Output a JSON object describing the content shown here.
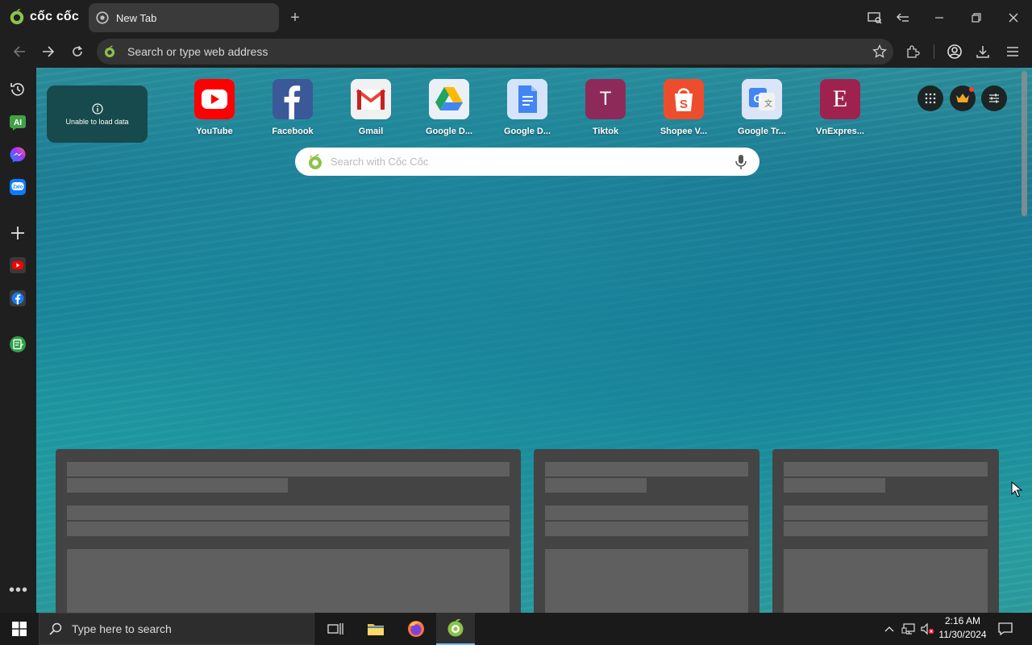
{
  "browser": {
    "brand_name": "cốc cốc",
    "tab_title": "New Tab",
    "address_placeholder": "Search or type web address"
  },
  "newtab": {
    "error_text": "Unable to load data",
    "shortcuts": [
      {
        "label": "YouTube",
        "icon": "youtube-icon",
        "color": "#ff0000"
      },
      {
        "label": "Facebook",
        "icon": "facebook-icon",
        "color": "#2d5aa5"
      },
      {
        "label": "Gmail",
        "icon": "gmail-icon",
        "color": "#ea4335"
      },
      {
        "label": "Google D...",
        "icon": "google-drive-icon",
        "color": "#1fa463"
      },
      {
        "label": "Google D...",
        "icon": "google-docs-icon",
        "color": "#4285f4"
      },
      {
        "label": "Tiktok",
        "icon": "tiktok-letter-icon",
        "letter": "T",
        "color": "#8e2a5a"
      },
      {
        "label": "Shopee V...",
        "icon": "shopee-icon",
        "color": "#ee4d2d"
      },
      {
        "label": "Google Tr...",
        "icon": "google-translate-icon",
        "color": "#4a8af4"
      },
      {
        "label": "VnExpres...",
        "icon": "vnexpress-icon",
        "letter": "E",
        "color": "#9f224e"
      }
    ],
    "search_placeholder": "Search with Cốc Cốc"
  },
  "taskbar": {
    "search_placeholder": "Type here to search",
    "time": "2:16 AM",
    "date": "11/30/2024"
  },
  "colors": {
    "accent_green": "#8bc34a",
    "taskbar_active": "#76b9ed"
  }
}
